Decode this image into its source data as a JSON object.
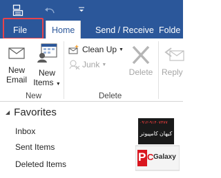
{
  "quick_access": {
    "icons": [
      "outlook-layout-icon",
      "undo-icon",
      "customize-qat-icon"
    ]
  },
  "tabs": [
    {
      "label": "File"
    },
    {
      "label": "Home"
    },
    {
      "label": "Send / Receive"
    },
    {
      "label": "Folde"
    }
  ],
  "ribbon": {
    "new_email": "New Email",
    "new_email_line1": "New",
    "new_email_line2": "Email",
    "new_items_line1": "New",
    "new_items_line2": "Items",
    "new_group": "New",
    "clean_up": "Clean Up",
    "junk": "Junk",
    "delete": "Delete",
    "delete_group": "Delete",
    "reply": "Reply"
  },
  "navigation": {
    "favorites": "Favorites",
    "items": [
      "Inbox",
      "Sent Items",
      "Deleted Items"
    ]
  },
  "watermark": {
    "brand_p": "P",
    "brand_c": "C",
    "brand_rest": "Galaxy",
    "fa_text": "کیهان کامپیوتر",
    "phone": "۰۹۱۲-۹۱۴۰۷۳۷۷"
  },
  "colors": {
    "accent": "#2b579a",
    "highlight": "#e8434b",
    "watermark_red": "#d9161f"
  }
}
